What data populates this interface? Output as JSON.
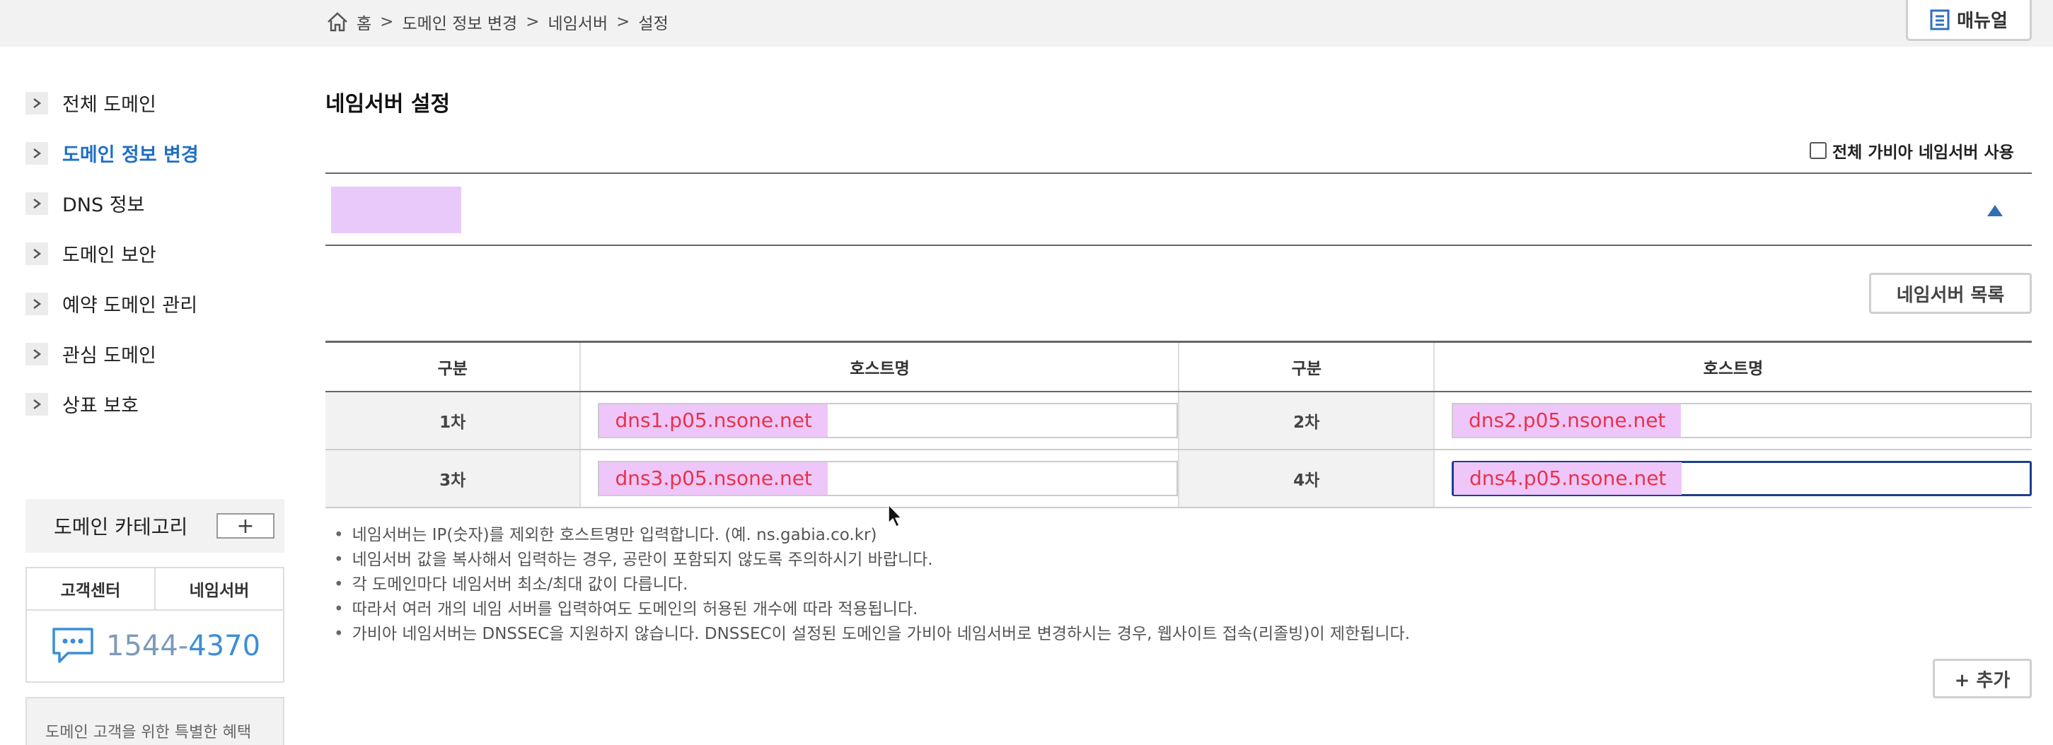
{
  "breadcrumb": {
    "home_icon": "home-icon",
    "items": [
      "홈",
      "도메인 정보 변경",
      "네임서버",
      "설정"
    ],
    "separator": ">"
  },
  "header": {
    "manual_label": "매뉴얼",
    "manual_icon": "document-icon"
  },
  "sidebar": {
    "items": [
      {
        "label": "전체 도메인",
        "active": false
      },
      {
        "label": "도메인 정보 변경",
        "active": true
      },
      {
        "label": "DNS 정보",
        "active": false
      },
      {
        "label": "도메인 보안",
        "active": false
      },
      {
        "label": "예약 도메인 관리",
        "active": false
      },
      {
        "label": "관심 도메인",
        "active": false
      },
      {
        "label": "상표 보호",
        "active": false
      }
    ],
    "category_label": "도메인 카테고리",
    "category_add": "+",
    "cs_tabs": [
      "고객센터",
      "네임서버"
    ],
    "phone_prefix": "1544-",
    "phone_suffix": "4370",
    "promo_text": "도메인 고객을 위한 특별한 혜택"
  },
  "main": {
    "title": "네임서버 설정",
    "all_gabia_label": "전체 가비아 네임서버 사용",
    "all_gabia_checked": false,
    "ns_list_button": "네임서버 목록",
    "table": {
      "headers": [
        "구분",
        "호스트명",
        "구분",
        "호스트명"
      ],
      "rows": [
        [
          {
            "label": "1차",
            "value": "dns1.p05.nsone.net"
          },
          {
            "label": "2차",
            "value": "dns2.p05.nsone.net"
          }
        ],
        [
          {
            "label": "3차",
            "value": "dns3.p05.nsone.net"
          },
          {
            "label": "4차",
            "value": "dns4.p05.nsone.net"
          }
        ]
      ]
    },
    "notes": [
      "네임서버는 IP(숫자)를 제외한 호스트명만 입력합니다. (예. ns.gabia.co.kr)",
      "네임서버 값을 복사해서 입력하는 경우, 공란이 포함되지 않도록 주의하시기 바랍니다.",
      "각 도메인마다 네임서버 최소/최대 값이 다릅니다.",
      "따라서 여러 개의 네임 서버를 입력하여도 도메인의 허용된 개수에 따라 적용됩니다.",
      "가비아 네임서버는 DNSSEC을 지원하지 않습니다. DNSSEC이 설정된 도메인을 가비아 네임서버로 변경하시는 경우, 웹사이트 접속(리졸빙)이 제한됩니다."
    ],
    "add_button": "+ 추가"
  },
  "colors": {
    "accent": "#1f6fc5",
    "value_text": "#e8334a",
    "highlight": "#eec6fa",
    "focus_border": "#1c3f8e"
  }
}
